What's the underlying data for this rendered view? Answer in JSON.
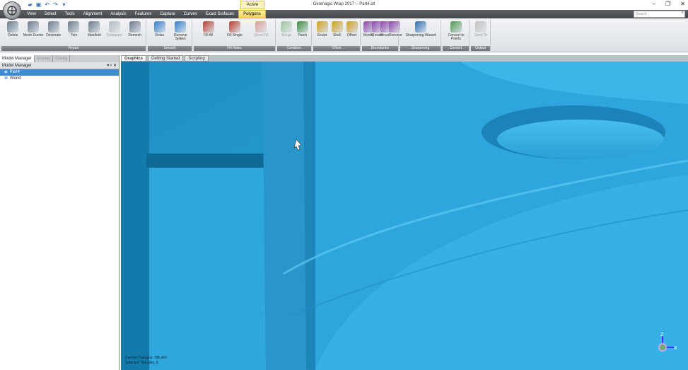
{
  "window": {
    "title": "Geomagic Wrap 2017 -- Part4.stl",
    "context_tab": "Active",
    "search_placeholder": "Search"
  },
  "menu": [
    "View",
    "Select",
    "Tools",
    "Alignment",
    "Analysis",
    "Features",
    "Capture",
    "Curves",
    "Exact Surfaces",
    "Polygons"
  ],
  "active_menu": "Polygons",
  "ribbon": {
    "groups": [
      {
        "label": "Repair",
        "tools": [
          "Delete",
          "Mesh Doctor",
          "Decimate",
          "Trim",
          "Manifold",
          "Defeature",
          "Remesh"
        ]
      },
      {
        "label": "Smooth",
        "tools": [
          "Relax",
          "Remove Spikes"
        ]
      },
      {
        "label": "Fill Holes",
        "tools": [
          "Fill All",
          "Fill Single",
          "Show Fill"
        ]
      },
      {
        "label": "Combine",
        "tools": [
          "Merge",
          "Patch"
        ]
      },
      {
        "label": "Offset",
        "tools": [
          "Sculpt",
          "Shell",
          "Offset"
        ]
      },
      {
        "label": "Boundaries",
        "tools": [
          "Modify",
          "Create",
          "Move",
          "Remove"
        ]
      },
      {
        "label": "Sharpening",
        "tools": [
          "Sharpening Wizard"
        ]
      },
      {
        "label": "Convert",
        "tools": [
          "Convert to Points"
        ]
      },
      {
        "label": "Output",
        "tools": [
          "Send To"
        ]
      }
    ]
  },
  "left_panel": {
    "tabs": [
      "Model Manager",
      "Display",
      "Dialog"
    ],
    "active_tab": "Model Manager",
    "header": "Model Manager",
    "pin": "▾ ᵖ ✕",
    "tree": [
      {
        "label": "Part4",
        "selected": true
      },
      {
        "label": "World",
        "selected": false
      }
    ]
  },
  "view_tabs": [
    "Graphics",
    "Getting Started",
    "Scripting"
  ],
  "active_view_tab": "Graphics",
  "status": {
    "current_triangles": "Current Triangles: 785,401",
    "selected_triangles": "Selected Triangles: 0"
  },
  "triad": {
    "z": "Z",
    "x": "X"
  },
  "colors": {
    "mesh": "#2a9fd2",
    "ribbon": "#e6e9ec",
    "menubar": "#4f5358",
    "accent_tab": "#f7d35a"
  }
}
